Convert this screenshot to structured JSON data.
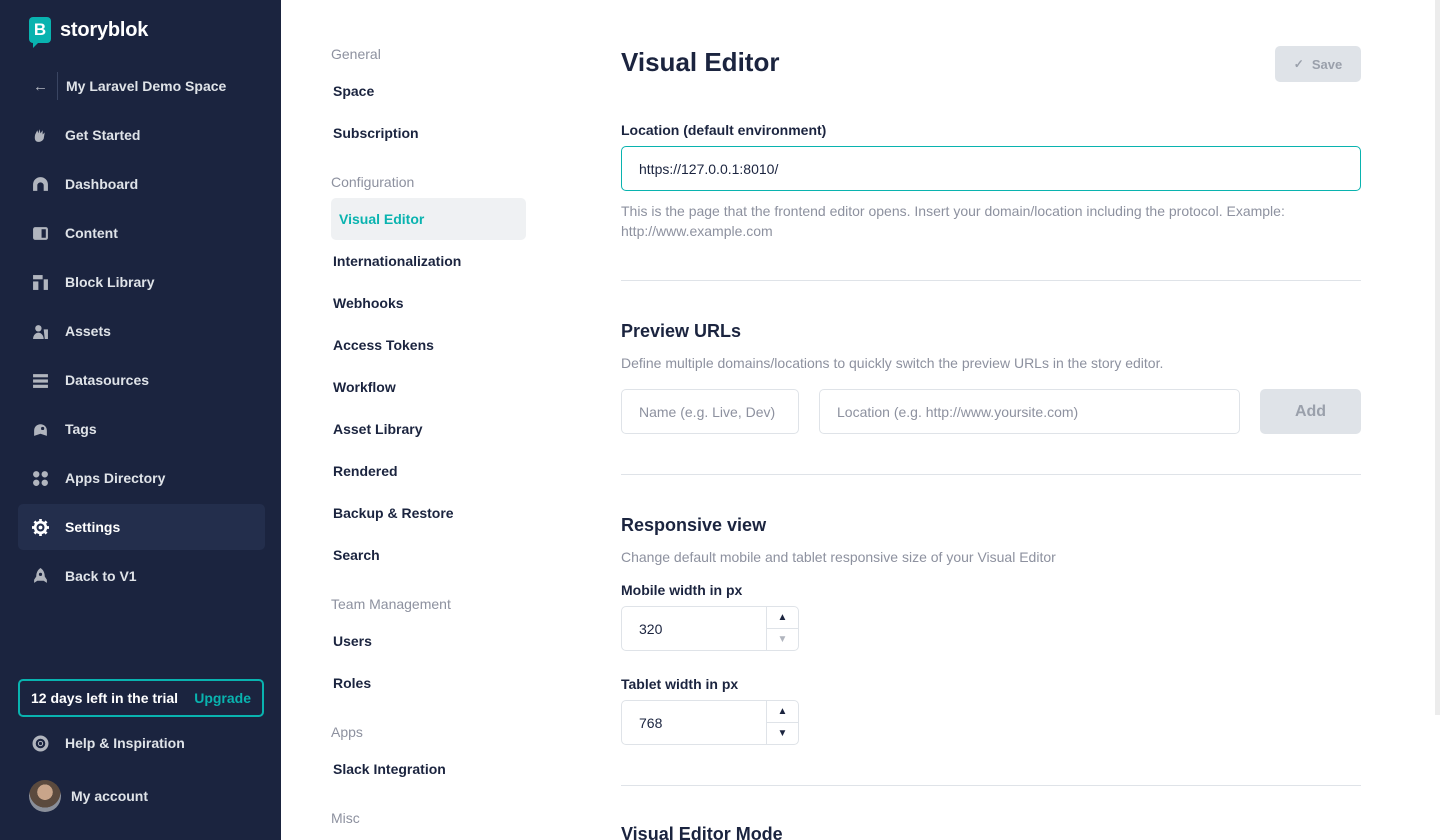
{
  "brand": {
    "name": "storyblok",
    "mark": "B"
  },
  "sidebar": {
    "space_name": "My Laravel Demo Space",
    "items": [
      {
        "label": "Get Started",
        "icon": "hand-icon"
      },
      {
        "label": "Dashboard",
        "icon": "dashboard-icon"
      },
      {
        "label": "Content",
        "icon": "content-icon"
      },
      {
        "label": "Block Library",
        "icon": "block-library-icon"
      },
      {
        "label": "Assets",
        "icon": "assets-icon"
      },
      {
        "label": "Datasources",
        "icon": "datasources-icon"
      },
      {
        "label": "Tags",
        "icon": "tag-icon"
      },
      {
        "label": "Apps Directory",
        "icon": "apps-icon"
      },
      {
        "label": "Settings",
        "icon": "gear-icon",
        "active": true
      },
      {
        "label": "Back to V1",
        "icon": "rocket-icon"
      }
    ],
    "trial_text": "12 days left in the trial",
    "upgrade_label": "Upgrade",
    "help_label": "Help & Inspiration",
    "account_label": "My account"
  },
  "settings_menu": {
    "sections": {
      "general": "General",
      "configuration": "Configuration",
      "team": "Team Management",
      "apps": "Apps",
      "misc": "Misc"
    },
    "general_items": [
      "Space",
      "Subscription"
    ],
    "configuration_items": [
      "Visual Editor",
      "Internationalization",
      "Webhooks",
      "Access Tokens",
      "Workflow",
      "Asset Library",
      "Rendered",
      "Backup & Restore",
      "Search"
    ],
    "team_items": [
      "Users",
      "Roles"
    ],
    "apps_items": [
      "Slack Integration"
    ],
    "active": "Visual Editor"
  },
  "main": {
    "title": "Visual Editor",
    "save_label": "Save",
    "location": {
      "label": "Location (default environment)",
      "value": "https://127.0.0.1:8010/",
      "help": "This is the page that the frontend editor opens. Insert your domain/location including the protocol. Example: http://www.example.com"
    },
    "preview": {
      "title": "Preview URLs",
      "description": "Define multiple domains/locations to quickly switch the preview URLs in the story editor.",
      "name_placeholder": "Name (e.g. Live, Dev)",
      "location_placeholder": "Location (e.g. http://www.yoursite.com)",
      "add_label": "Add"
    },
    "responsive": {
      "title": "Responsive view",
      "description": "Change default mobile and tablet responsive size of your Visual Editor",
      "mobile_label": "Mobile width in px",
      "mobile_value": "320",
      "tablet_label": "Tablet width in px",
      "tablet_value": "768"
    },
    "mode_title": "Visual Editor Mode"
  },
  "colors": {
    "accent": "#09b3af",
    "sidebar_bg": "#1b243f"
  }
}
